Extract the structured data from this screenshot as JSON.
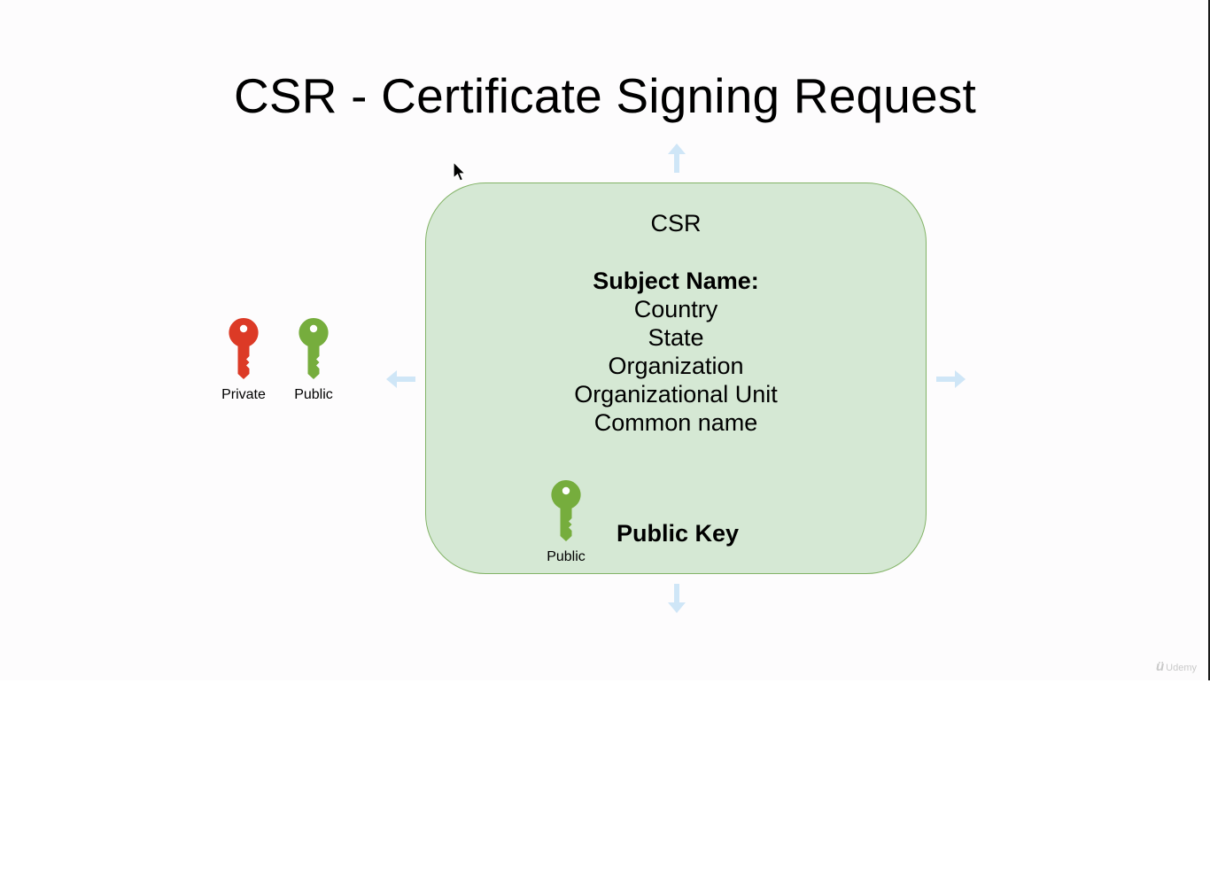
{
  "slide": {
    "title": "CSR - Certificate Signing Request"
  },
  "keys": {
    "private_label": "Private",
    "public_label": "Public",
    "private_color": "#dc3a26",
    "public_color": "#76ad3d"
  },
  "csr_box": {
    "heading": "CSR",
    "subject_title": "Subject Name:",
    "subject_fields": [
      "Country",
      "State",
      "Organization",
      "Organizational Unit",
      "Common name"
    ],
    "public_key_label": "Public Key",
    "inner_key_label": "Public",
    "fill_color": "#d5e8d4",
    "border_color": "#82b366"
  },
  "watermark": {
    "logo": "ü",
    "text": "Udemy"
  },
  "icons": [
    "key-icon",
    "arrow-up-icon",
    "arrow-down-icon",
    "arrow-left-icon",
    "arrow-right-icon",
    "mouse-cursor-icon"
  ]
}
